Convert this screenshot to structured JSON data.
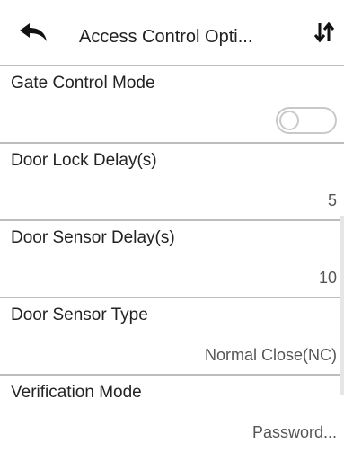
{
  "header": {
    "title": "Access Control Opti...",
    "back_icon": "back-arrow-icon",
    "sort_icon": "sort-arrows-icon"
  },
  "settings": [
    {
      "label": "Gate Control Mode",
      "type": "toggle",
      "enabled": false
    },
    {
      "label": "Door Lock Delay(s)",
      "value": "5"
    },
    {
      "label": "Door Sensor Delay(s)",
      "value": "10"
    },
    {
      "label": "Door Sensor Type",
      "value": "Normal Close(NC)"
    },
    {
      "label": "Verification Mode",
      "value": "Password..."
    }
  ],
  "colors": {
    "divider": "#bdbdbd",
    "toggle_off": "#c9c9c9"
  }
}
